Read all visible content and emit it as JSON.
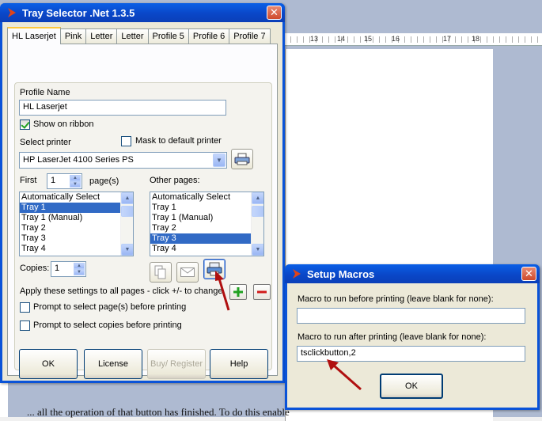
{
  "background": {
    "ruler_labels": [
      "13",
      "14",
      "15",
      "16",
      "17",
      "18"
    ],
    "bottom_text": "... all the operation of that button has finished. To do this enable"
  },
  "tray_selector": {
    "title": "Tray Selector .Net 1.3.5",
    "tabs": [
      "HL Laserjet",
      "Pink",
      "Letter",
      "Letter",
      "Profile 5",
      "Profile 6",
      "Profile 7"
    ],
    "profile_name_label": "Profile Name",
    "profile_name_value": "HL Laserjet",
    "show_on_ribbon_label": "Show on ribbon",
    "show_on_ribbon_checked": true,
    "select_printer_label": "Select printer",
    "mask_default_label": "Mask to default printer",
    "mask_default_checked": false,
    "printer_value": "HP LaserJet 4100 Series PS",
    "first_label": "First",
    "first_value": "1",
    "pages_label": "page(s)",
    "other_pages_label": "Other pages:",
    "first_tray_list": [
      {
        "label": "Automatically Select",
        "selected": false
      },
      {
        "label": "Tray 1",
        "selected": true
      },
      {
        "label": "Tray 1 (Manual)",
        "selected": false
      },
      {
        "label": "Tray 2",
        "selected": false
      },
      {
        "label": "Tray 3",
        "selected": false
      },
      {
        "label": "Tray 4",
        "selected": false
      }
    ],
    "other_tray_list": [
      {
        "label": "Automatically Select",
        "selected": false
      },
      {
        "label": "Tray 1",
        "selected": false
      },
      {
        "label": "Tray 1 (Manual)",
        "selected": false
      },
      {
        "label": "Tray 2",
        "selected": false
      },
      {
        "label": "Tray 3",
        "selected": true
      },
      {
        "label": "Tray 4",
        "selected": false
      }
    ],
    "copies_label": "Copies:",
    "copies_value": "1",
    "apply_text": "Apply these settings to all pages - click +/- to change",
    "prompt_pages_label": "Prompt to select page(s) before printing",
    "prompt_copies_label": "Prompt to select copies before printing",
    "buttons": {
      "ok": "OK",
      "license": "License",
      "buy_register": "Buy/ Register",
      "help": "Help"
    }
  },
  "setup_macros": {
    "title": "Setup Macros",
    "before_label": "Macro to run before printing (leave blank for none):",
    "before_value": "",
    "after_label": "Macro to run after printing (leave blank for none):",
    "after_value": "tsclickbutton,2",
    "ok": "OK"
  },
  "colors": {
    "title_bar": "#0a53d8",
    "selection": "#316ac5",
    "annotation_arrow": "#b01010",
    "add_green": "#21a121",
    "remove_red": "#d01a1a"
  }
}
